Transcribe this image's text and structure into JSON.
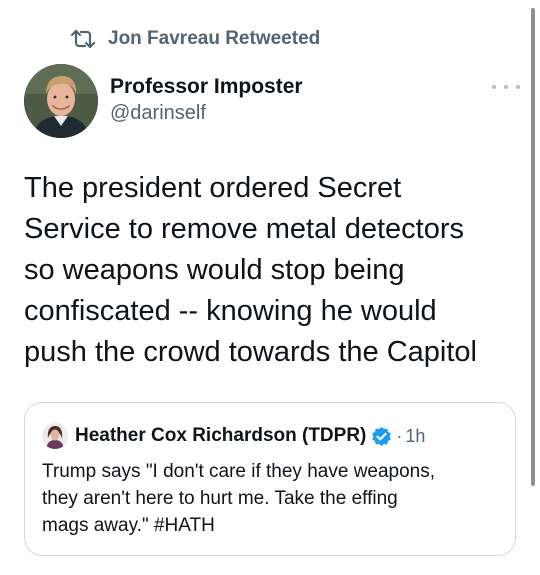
{
  "retweet": {
    "icon": "retweet-icon",
    "text": "Jon Favreau Retweeted"
  },
  "tweet": {
    "author_name": "Professor Imposter",
    "author_handle": "@darinself",
    "avatar_icon": "avatar-photo",
    "more_icon": "more-options-icon",
    "text_lines": [
      "The president ordered Secret",
      "Service to remove metal detectors",
      "so weapons would stop being",
      "confiscated -- knowing he would",
      "push the crowd towards the Capitol"
    ]
  },
  "quote": {
    "author_name": "Heather Cox Richardson (TDPR)",
    "verified_icon": "verified-badge-icon",
    "separator": "·",
    "time": "1h",
    "text_lines": [
      "Trump says \"I don't care if they have weapons,",
      "they aren't here to hurt me. Take the effing",
      "mags away.\" #HATH"
    ]
  },
  "colors": {
    "text_primary": "#0f1419",
    "text_secondary": "#536471",
    "verified_blue": "#1d9bf0",
    "card_border": "#cfd9de"
  }
}
